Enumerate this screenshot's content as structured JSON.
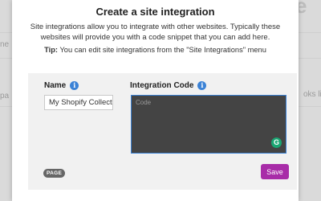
{
  "modal": {
    "title": "Create a site integration",
    "description": "Site integrations allow you to integrate with other websites. Typically these websites will provide you with a code snippet that you can add here.",
    "tip_label": "Tip:",
    "tip_text": "You can edit site integrations from the \"Site Integrations\" menu"
  },
  "form": {
    "name_label": "Name",
    "name_value": "My Shopify Collect",
    "code_label": "Integration Code",
    "code_placeholder": "Code",
    "badge": "PAGE",
    "save_label": "Save"
  },
  "background": {
    "title_fragment": "e",
    "left_fragment_1": "ne",
    "left_fragment_2": "pa",
    "right_fragment": "oks lik"
  },
  "colors": {
    "accent_button": "#a82ca8",
    "info_icon": "#3b82d6",
    "code_bg": "#444444"
  }
}
